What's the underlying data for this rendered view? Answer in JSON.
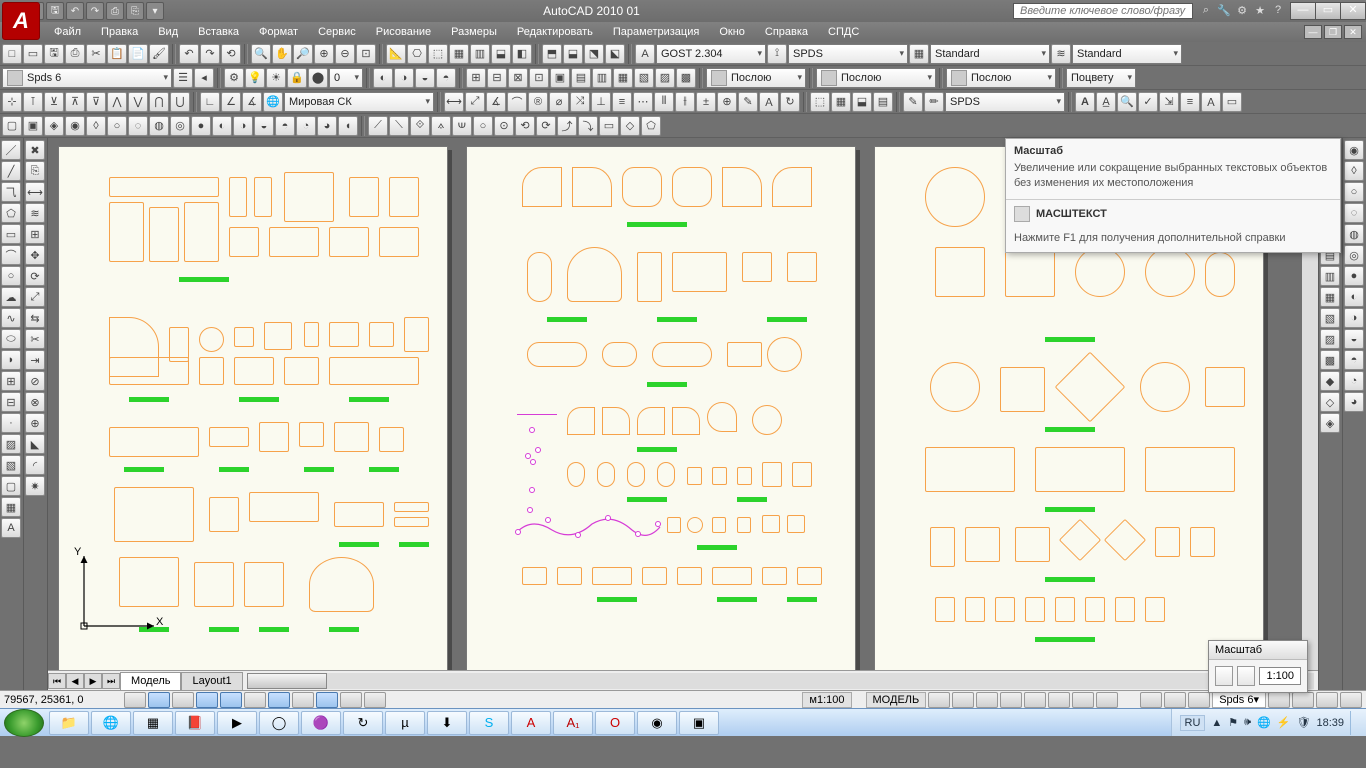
{
  "app": {
    "title": "AutoCAD 2010    01",
    "search_placeholder": "Введите ключевое слово/фразу"
  },
  "menu": {
    "items": [
      "Файл",
      "Правка",
      "Вид",
      "Вставка",
      "Формат",
      "Сервис",
      "Рисование",
      "Размеры",
      "Редактировать",
      "Параметризация",
      "Окно",
      "Справка",
      "СПДС"
    ]
  },
  "qat": [
    "□",
    "▭",
    "🖫",
    "↶",
    "↷",
    "⎙",
    "⎘"
  ],
  "title_icons": [
    "⌕",
    "🔧",
    "⚙",
    "★",
    "?"
  ],
  "combos": {
    "text_style": "GOST 2.304",
    "dim_style": "SPDS",
    "table_style": "Standard",
    "ml_style": "Standard",
    "layer": "Spds 6",
    "linecolor": "Послою",
    "linetype": "Послою",
    "lineweight": "Послою",
    "plotstyle": "Поцвету",
    "ucs": "Мировая СК",
    "spds": "SPDS",
    "num": "0"
  },
  "tooltip": {
    "title": "Масштаб",
    "desc": "Увеличение или сокращение выбранных текстовых объектов без изменения их местоположения",
    "command": "МАСШТЕКСТ",
    "help": "Нажмите F1 для получения дополнительной справки"
  },
  "scale_panel": {
    "title": "Масштаб",
    "value": "1:100"
  },
  "tabs": {
    "model": "Модель",
    "layout1": "Layout1"
  },
  "status": {
    "coords": "79567, 25361, 0",
    "scale": "м1:100",
    "mode": "МОДЕЛЬ",
    "spds": "Spds 6"
  },
  "tray": {
    "lang": "RU",
    "time": "18:39"
  },
  "ucs_labels": {
    "x": "X",
    "y": "Y"
  }
}
